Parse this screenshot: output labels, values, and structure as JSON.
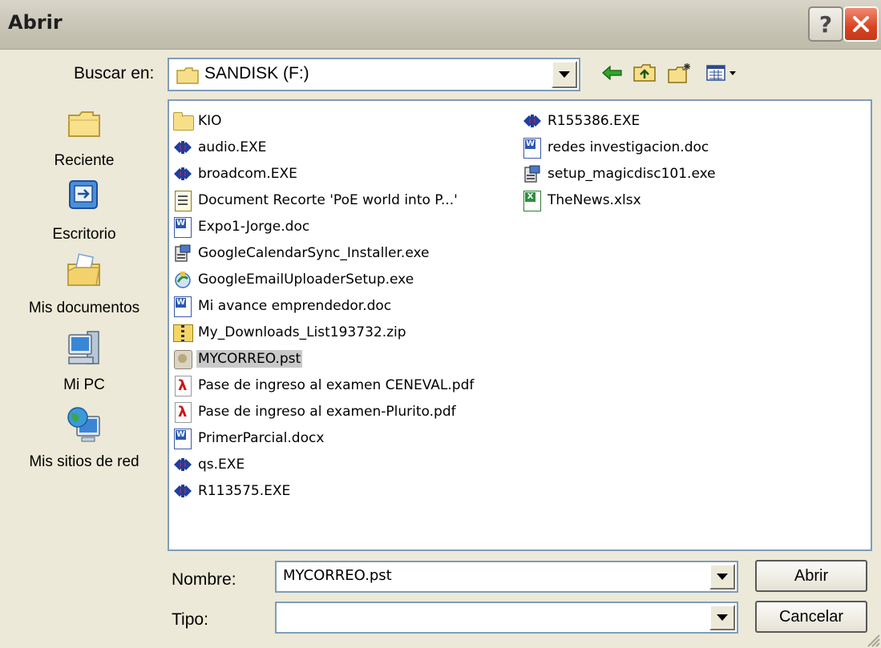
{
  "window": {
    "title": "Abrir"
  },
  "look_in": {
    "label": "Buscar en:",
    "value": "SANDISK (F:)"
  },
  "places": [
    {
      "label": "Reciente",
      "icon": "recent-folder-icon"
    },
    {
      "label": "Escritorio",
      "icon": "desktop-icon"
    },
    {
      "label": "Mis documentos",
      "icon": "my-documents-icon"
    },
    {
      "label": "Mi PC",
      "icon": "my-computer-icon"
    },
    {
      "label": "Mis sitios de red",
      "icon": "network-places-icon"
    }
  ],
  "files_col1": [
    {
      "name": "KIO",
      "icon": "folder-icon"
    },
    {
      "name": "audio.EXE",
      "icon": "exe-icon"
    },
    {
      "name": "broadcom.EXE",
      "icon": "exe-icon"
    },
    {
      "name": "Document Recorte 'PoE world into P...'",
      "icon": "text-document-icon"
    },
    {
      "name": "Expo1-Jorge.doc",
      "icon": "word-document-icon"
    },
    {
      "name": "GoogleCalendarSync_Installer.exe",
      "icon": "installer-icon"
    },
    {
      "name": "GoogleEmailUploaderSetup.exe",
      "icon": "setup-icon"
    },
    {
      "name": "Mi avance emprendedor.doc",
      "icon": "word-document-icon"
    },
    {
      "name": "My_Downloads_List193732.zip",
      "icon": "zip-icon"
    },
    {
      "name": "MYCORREO.pst",
      "icon": "pst-icon",
      "selected": true
    },
    {
      "name": "Pase de ingreso al examen CENEVAL.pdf",
      "icon": "pdf-icon"
    },
    {
      "name": "Pase de ingreso al examen-Plurito.pdf",
      "icon": "pdf-icon"
    },
    {
      "name": "PrimerParcial.docx",
      "icon": "word-document-icon"
    },
    {
      "name": "qs.EXE",
      "icon": "exe-icon"
    },
    {
      "name": "R113575.EXE",
      "icon": "exe-icon"
    }
  ],
  "files_col2": [
    {
      "name": "R155386.EXE",
      "icon": "exe-icon"
    },
    {
      "name": "redes investigacion.doc",
      "icon": "word-document-icon"
    },
    {
      "name": "setup_magicdisc101.exe",
      "icon": "installer-icon"
    },
    {
      "name": "TheNews.xlsx",
      "icon": "excel-document-icon"
    }
  ],
  "filename": {
    "label": "Nombre:",
    "value": "MYCORREO.pst"
  },
  "filetype": {
    "label": "Tipo:",
    "value": ""
  },
  "buttons": {
    "open": "Abrir",
    "cancel": "Cancelar",
    "help": "?"
  },
  "colors": {
    "dialog_bg": "#ece9d8",
    "selection": "#c9c9c9",
    "close_red": "#d9421f",
    "field_border": "#7f9db9"
  }
}
